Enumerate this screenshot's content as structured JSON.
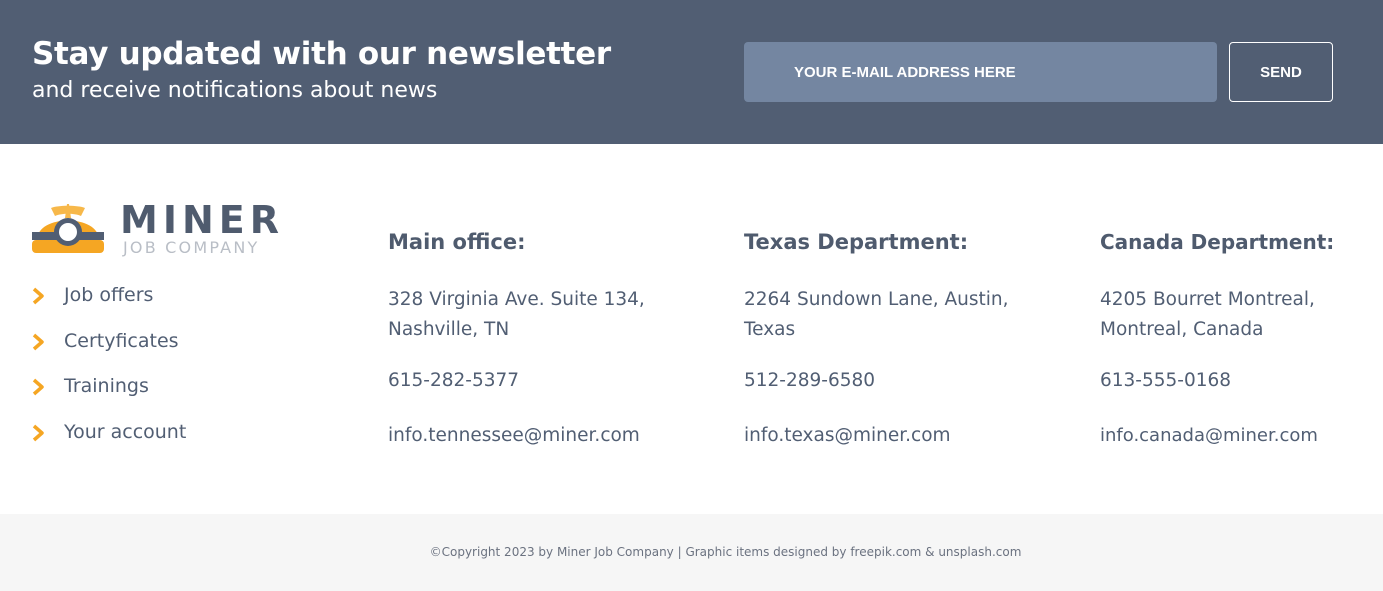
{
  "newsletter": {
    "title": "Stay updated with our newsletter",
    "subtitle": "and receive notifications about news",
    "email_placeholder": "YOUR E-MAIL ADDRESS HERE",
    "send_label": "SEND"
  },
  "logo": {
    "name": "MINER",
    "tagline": "JOB COMPANY",
    "icon": "miner-helmet-icon",
    "colors": {
      "helmet": "#f5a623",
      "dark": "#4f5b6e",
      "light": "#b9bec6"
    }
  },
  "nav": {
    "icon": "chevron-right-icon",
    "accent": "#f5a623",
    "items": [
      {
        "label": "Job offers"
      },
      {
        "label": "Certyficates"
      },
      {
        "label": "Trainings"
      },
      {
        "label": "Your account"
      }
    ]
  },
  "offices": [
    {
      "title": "Main office:",
      "address_line1": "328 Virginia Ave. Suite 134,",
      "address_line2": "Nashville, TN",
      "phone": "615-282-5377",
      "email": "info.tennessee@miner.com"
    },
    {
      "title": "Texas Department:",
      "address_line1": "2264 Sundown Lane, Austin,",
      "address_line2": "Texas",
      "phone": "512-289-6580",
      "email": "info.texas@miner.com"
    },
    {
      "title": "Canada Department:",
      "address_line1": "4205 Bourret Montreal,",
      "address_line2": "Montreal, Canada",
      "phone": "613-555-0168",
      "email": "info.canada@miner.com"
    }
  ],
  "footer": {
    "copyright": "©Copyright 2023 by Miner Job Company | Graphic items designed by freepik.com & unsplash.com"
  },
  "colors": {
    "newsletter_bg": "#515e73",
    "input_bg": "#7486a1",
    "footer_bg": "#f6f6f6",
    "text": "#4f5b6e"
  }
}
